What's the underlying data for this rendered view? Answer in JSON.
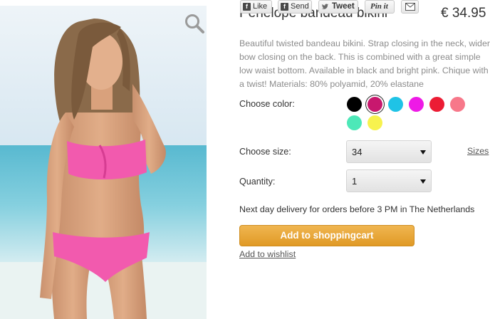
{
  "product": {
    "title": "Penelope bandeau bikini",
    "price": "€ 34.95",
    "description": "Beautiful twisted bandeau bikini. Strap closing in the neck, wider bow closing on the back. This is combined with a great simple low waist bottom. Available in black and bright pink. Chique with a twist! Materials: 80% polyamid, 20% elastane",
    "image_icon": "magnifier-zoom-icon"
  },
  "options": {
    "color_label": "Choose color:",
    "colors": [
      {
        "hex": "#000000",
        "selected": false
      },
      {
        "hex": "#c8186e",
        "selected": true
      },
      {
        "hex": "#1fc3e6",
        "selected": false
      },
      {
        "hex": "#ee1ae6",
        "selected": false
      },
      {
        "hex": "#ec1c34",
        "selected": false
      },
      {
        "hex": "#f7788a",
        "selected": false
      },
      {
        "hex": "#4de8b8",
        "selected": false
      },
      {
        "hex": "#f7f24e",
        "selected": false
      }
    ],
    "size_label": "Choose size:",
    "size_value": "34",
    "sizes_link": "Sizes",
    "quantity_label": "Quantity:",
    "quantity_value": "1"
  },
  "delivery_text": "Next day delivery for orders before 3 PM in The Netherlands",
  "actions": {
    "add_to_cart": "Add to shoppingcart",
    "add_to_wishlist": "Add to wishlist"
  },
  "social": {
    "like": "Like",
    "send": "Send",
    "tweet": "Tweet",
    "pin": "Pin it",
    "mail_icon": "envelope-icon"
  },
  "colors": {
    "accent_orange": "#e8a63a",
    "text_grey": "#8c8c8c"
  }
}
